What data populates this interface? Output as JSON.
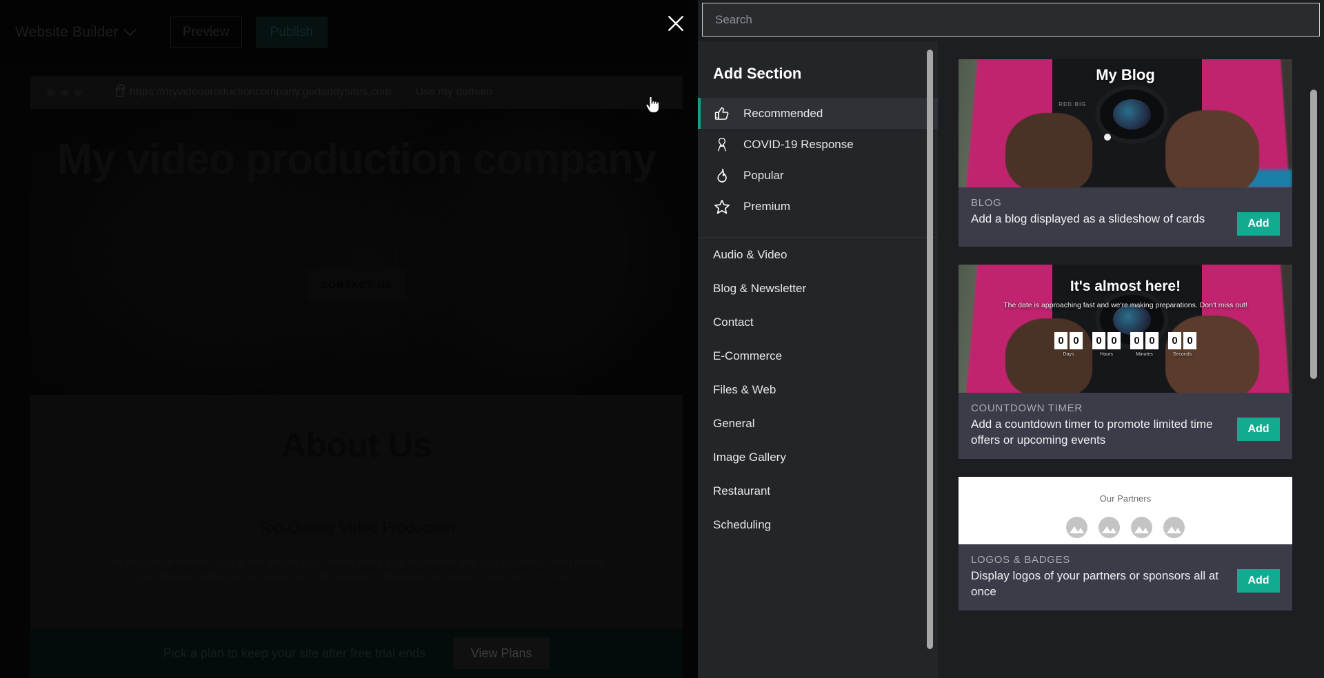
{
  "topbar": {
    "brand_label": "Website Builder",
    "preview_label": "Preview",
    "publish_label": "Publish"
  },
  "browser": {
    "url": "https://myvideoproductioncompany.godaddysites.com",
    "use_my_domain_label": "Use my domain"
  },
  "site": {
    "hero_heading": "My video production company",
    "hero_cta_label": "CONTACT US",
    "about_heading": "About Us",
    "about_subheading": "Top-Quality Video Production",
    "about_body": "I'm your About section. Click to edit and tell your visitors about your experience and your approach. What makes you different? What are you known for in the industry? What kinds of shows do you film? TV? Film?"
  },
  "plan_banner": {
    "message": "Pick a plan to keep your site after free trial ends",
    "button_label": "View Plans"
  },
  "panel": {
    "close_label": "Close",
    "search_placeholder": "Search",
    "search_value": "",
    "title": "Add Section",
    "accent_color": "#17a08a",
    "add_button_color": "#12ab92",
    "filters": [
      {
        "label": "Recommended",
        "icon": "thumbs-up-icon",
        "active": true
      },
      {
        "label": "COVID-19 Response",
        "icon": "ribbon-icon",
        "active": false
      },
      {
        "label": "Popular",
        "icon": "flame-icon",
        "active": false
      },
      {
        "label": "Premium",
        "icon": "star-icon",
        "active": false
      }
    ],
    "categories": [
      {
        "label": "Audio & Video"
      },
      {
        "label": "Blog & Newsletter"
      },
      {
        "label": "Contact"
      },
      {
        "label": "E-Commerce"
      },
      {
        "label": "Files & Web"
      },
      {
        "label": "General"
      },
      {
        "label": "Image Gallery"
      },
      {
        "label": "Restaurant"
      },
      {
        "label": "Scheduling"
      }
    ],
    "cards": [
      {
        "kicker": "BLOG",
        "description": "Add a blog displayed as a slideshow of cards",
        "add_label": "Add",
        "preview_kind": "blog",
        "preview_title": "My Blog"
      },
      {
        "kicker": "COUNTDOWN TIMER",
        "description": "Add a countdown timer to promote limited time offers or upcoming events",
        "add_label": "Add",
        "preview_kind": "countdown",
        "preview_title": "It's almost here!",
        "preview_subtitle": "The date is approaching fast and we're making preparations. Don't miss out!",
        "countdown": [
          {
            "label": "Days",
            "digits": [
              "0",
              "0"
            ]
          },
          {
            "label": "Hours",
            "digits": [
              "0",
              "0"
            ]
          },
          {
            "label": "Minutes",
            "digits": [
              "0",
              "0"
            ]
          },
          {
            "label": "Seconds",
            "digits": [
              "0",
              "0"
            ]
          }
        ]
      },
      {
        "kicker": "LOGOS & BADGES",
        "description": "Display logos of your partners or sponsors all at once",
        "add_label": "Add",
        "preview_kind": "partners",
        "preview_title": "Our Partners",
        "logo_count": 4
      }
    ]
  }
}
